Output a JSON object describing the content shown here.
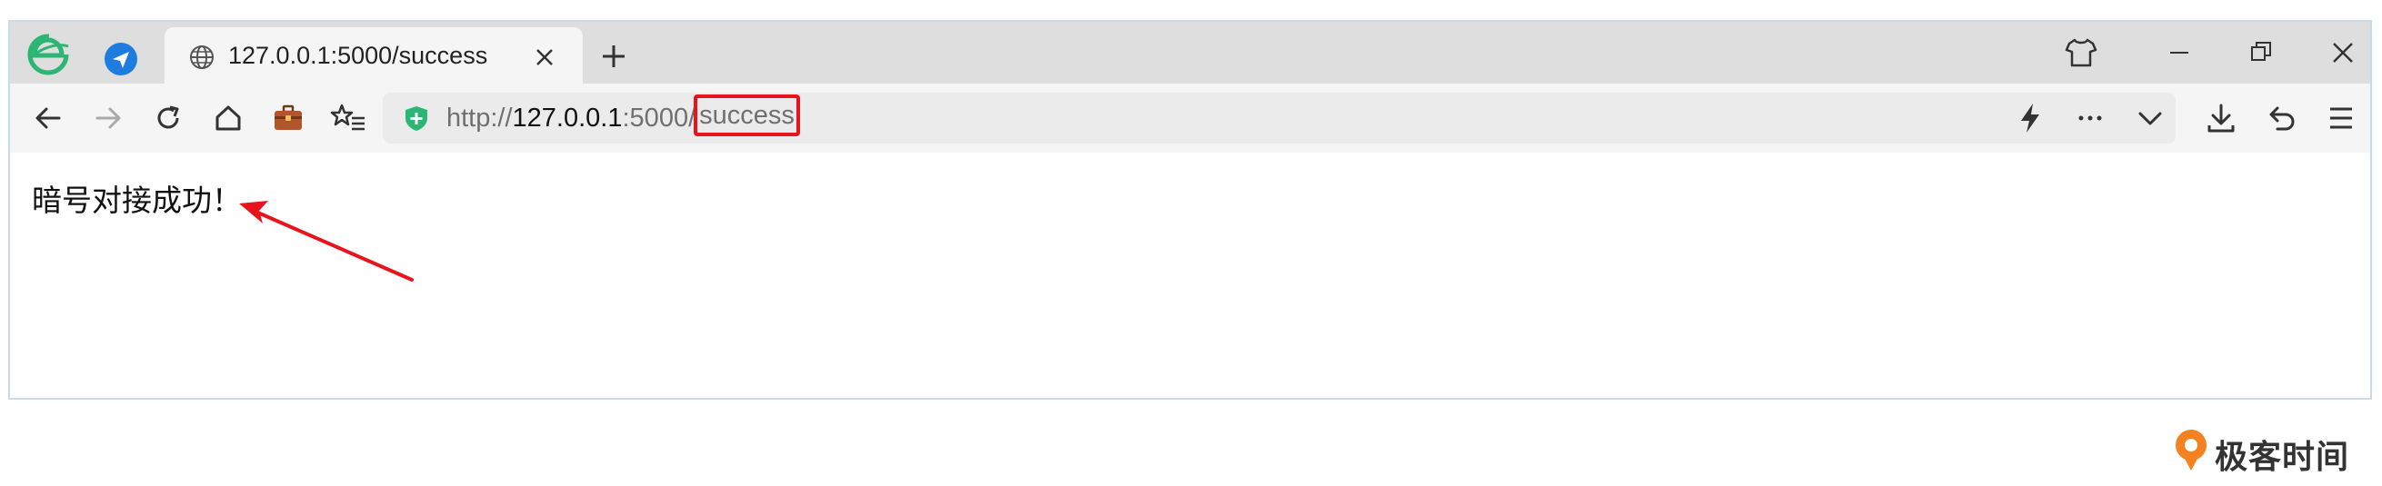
{
  "browser": {
    "tab": {
      "title": "127.0.0.1:5000/success"
    },
    "address_bar": {
      "scheme": "http://",
      "host": "127.0.0.1",
      "port": ":5000/",
      "path": "success"
    },
    "icons": {
      "app_logo": "browser-e-logo-icon",
      "navigator": "send-arrow-icon",
      "globe": "globe-icon",
      "skin": "tshirt-icon",
      "accent_green": "#2bb673",
      "highlight_red": "#e8141b"
    }
  },
  "page": {
    "message": "暗号对接成功！"
  },
  "watermark": {
    "brand": "极客时间"
  }
}
